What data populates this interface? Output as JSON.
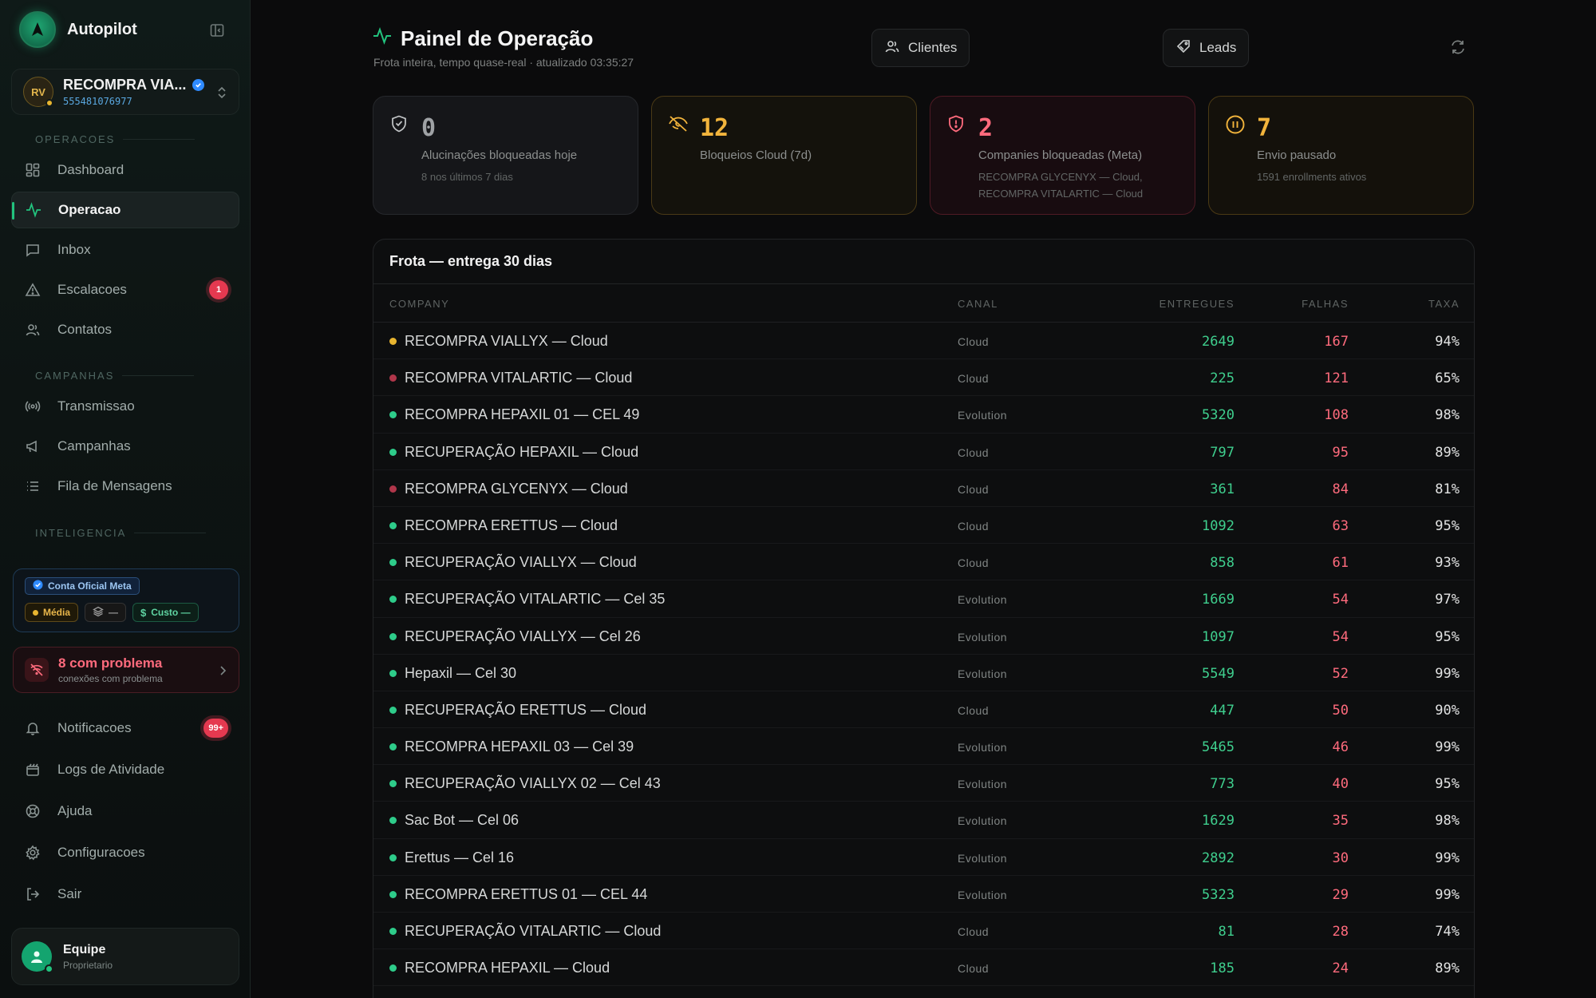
{
  "app": {
    "name": "Autopilot"
  },
  "account": {
    "initials": "RV",
    "name": "RECOMPRA VIA...",
    "phone": "555481076977"
  },
  "sidebar": {
    "sections": {
      "operacoes": "OPERACOES",
      "campanhas": "CAMPANHAS",
      "inteligencia": "INTELIGENCIA"
    },
    "items": [
      {
        "label": "Dashboard",
        "icon": "grid-icon"
      },
      {
        "label": "Operacao",
        "icon": "activity-icon",
        "active": true
      },
      {
        "label": "Inbox",
        "icon": "message-icon"
      },
      {
        "label": "Escalacoes",
        "icon": "warning-icon",
        "badge": "1"
      },
      {
        "label": "Contatos",
        "icon": "users-icon"
      },
      {
        "label": "Transmissao",
        "icon": "broadcast-icon"
      },
      {
        "label": "Campanhas",
        "icon": "megaphone-icon"
      },
      {
        "label": "Fila de Mensagens",
        "icon": "list-icon"
      },
      {
        "label": "Notificacoes",
        "icon": "bell-icon",
        "badge": "99+"
      },
      {
        "label": "Logs de Atividade",
        "icon": "logs-icon"
      },
      {
        "label": "Ajuda",
        "icon": "help-icon"
      },
      {
        "label": "Configuracoes",
        "icon": "gear-icon"
      },
      {
        "label": "Sair",
        "icon": "logout-icon"
      }
    ],
    "meta": {
      "official": "Conta Oficial Meta",
      "quality": "Média",
      "layers": "—",
      "cost": "Custo —"
    },
    "problems": {
      "title": "8 com problema",
      "subtitle": "conexões com problema"
    },
    "user": {
      "name": "Equipe",
      "role": "Proprietario"
    }
  },
  "header": {
    "title": "Painel de Operação",
    "subtitle": "Frota inteira, tempo quase-real · atualizado 03:35:27",
    "clients_btn": "Clientes",
    "leads_btn": "Leads"
  },
  "cards": [
    {
      "value": "0",
      "label": "Alucinações bloqueadas hoje",
      "sub": "8 nos últimos 7 dias"
    },
    {
      "value": "12",
      "label": "Bloqueios Cloud (7d)",
      "sub": ""
    },
    {
      "value": "2",
      "label": "Companies bloqueadas (Meta)",
      "sub": "RECOMPRA GLYCENYX — Cloud, RECOMPRA VITALARTIC — Cloud"
    },
    {
      "value": "7",
      "label": "Envio pausado",
      "sub": "1591 enrollments ativos"
    }
  ],
  "table": {
    "title": "Frota — entrega 30 dias",
    "headers": {
      "company": "COMPANY",
      "canal": "CANAL",
      "entregues": "ENTREGUES",
      "falhas": "FALHAS",
      "taxa": "TAXA"
    },
    "status_colors": {
      "ok": "#2ecc8a",
      "warn": "#e8b530",
      "blocked": "#b0364a"
    },
    "rows": [
      {
        "company": "RECOMPRA VIALLYX — Cloud",
        "canal": "Cloud",
        "entregues": "2649",
        "falhas": "167",
        "taxa": "94%",
        "status": "warn"
      },
      {
        "company": "RECOMPRA VITALARTIC — Cloud",
        "canal": "Cloud",
        "entregues": "225",
        "falhas": "121",
        "taxa": "65%",
        "status": "blocked"
      },
      {
        "company": "RECOMPRA HEPAXIL 01 — CEL 49",
        "canal": "Evolution",
        "entregues": "5320",
        "falhas": "108",
        "taxa": "98%",
        "status": "ok"
      },
      {
        "company": "RECUPERAÇÃO HEPAXIL — Cloud",
        "canal": "Cloud",
        "entregues": "797",
        "falhas": "95",
        "taxa": "89%",
        "status": "ok"
      },
      {
        "company": "RECOMPRA GLYCENYX — Cloud",
        "canal": "Cloud",
        "entregues": "361",
        "falhas": "84",
        "taxa": "81%",
        "status": "blocked"
      },
      {
        "company": "RECOMPRA ERETTUS — Cloud",
        "canal": "Cloud",
        "entregues": "1092",
        "falhas": "63",
        "taxa": "95%",
        "status": "ok"
      },
      {
        "company": "RECUPERAÇÃO VIALLYX — Cloud",
        "canal": "Cloud",
        "entregues": "858",
        "falhas": "61",
        "taxa": "93%",
        "status": "ok"
      },
      {
        "company": "RECUPERAÇÃO VITALARTIC — Cel 35",
        "canal": "Evolution",
        "entregues": "1669",
        "falhas": "54",
        "taxa": "97%",
        "status": "ok"
      },
      {
        "company": "RECUPERAÇÃO VIALLYX — Cel 26",
        "canal": "Evolution",
        "entregues": "1097",
        "falhas": "54",
        "taxa": "95%",
        "status": "ok"
      },
      {
        "company": "Hepaxil — Cel 30",
        "canal": "Evolution",
        "entregues": "5549",
        "falhas": "52",
        "taxa": "99%",
        "status": "ok"
      },
      {
        "company": "RECUPERAÇÃO ERETTUS — Cloud",
        "canal": "Cloud",
        "entregues": "447",
        "falhas": "50",
        "taxa": "90%",
        "status": "ok"
      },
      {
        "company": "RECOMPRA HEPAXIL 03 — Cel 39",
        "canal": "Evolution",
        "entregues": "5465",
        "falhas": "46",
        "taxa": "99%",
        "status": "ok"
      },
      {
        "company": "RECUPERAÇÃO VIALLYX 02 — Cel 43",
        "canal": "Evolution",
        "entregues": "773",
        "falhas": "40",
        "taxa": "95%",
        "status": "ok"
      },
      {
        "company": "Sac Bot — Cel 06",
        "canal": "Evolution",
        "entregues": "1629",
        "falhas": "35",
        "taxa": "98%",
        "status": "ok"
      },
      {
        "company": "Erettus — Cel 16",
        "canal": "Evolution",
        "entregues": "2892",
        "falhas": "30",
        "taxa": "99%",
        "status": "ok"
      },
      {
        "company": "RECOMPRA ERETTUS 01 — CEL 44",
        "canal": "Evolution",
        "entregues": "5323",
        "falhas": "29",
        "taxa": "99%",
        "status": "ok"
      },
      {
        "company": "RECUPERAÇÃO VITALARTIC — Cloud",
        "canal": "Cloud",
        "entregues": "81",
        "falhas": "28",
        "taxa": "74%",
        "status": "ok"
      },
      {
        "company": "RECOMPRA HEPAXIL — Cloud",
        "canal": "Cloud",
        "entregues": "185",
        "falhas": "24",
        "taxa": "89%",
        "status": "ok"
      }
    ]
  }
}
